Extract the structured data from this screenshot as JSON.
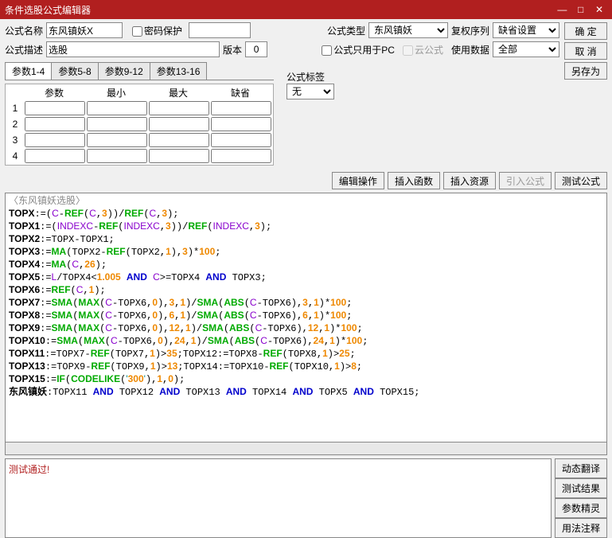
{
  "title": "条件选股公式编辑器",
  "labels": {
    "name": "公式名称",
    "pwd": "密码保护",
    "type": "公式类型",
    "fuquan": "复权序列",
    "desc": "公式描述",
    "ver": "版本",
    "pconly": "公式只用于PC",
    "cloud": "云公式",
    "usedata": "使用数据",
    "tag": "公式标签"
  },
  "fields": {
    "name": "东风镇妖X",
    "desc": "选股",
    "ver": "0",
    "type": "东风镇妖",
    "fuquan": "缺省设置",
    "usedata": "全部",
    "tag": "无"
  },
  "btns": {
    "ok": "确 定",
    "cancel": "取 消",
    "saveas": "另存为",
    "editop": "编辑操作",
    "insfunc": "插入函数",
    "insres": "插入资源",
    "import": "引入公式",
    "test": "测试公式",
    "dyntrans": "动态翻译",
    "testres": "测试结果",
    "paramwiz": "参数精灵",
    "usage": "用法注释"
  },
  "tabs": [
    "参数1-4",
    "参数5-8",
    "参数9-12",
    "参数13-16"
  ],
  "paramhdrs": [
    "参数",
    "最小",
    "最大",
    "缺省"
  ],
  "paramrows": [
    1,
    2,
    3,
    4
  ],
  "status": "测试通过!",
  "code_title": "〈东风镇妖选股〉",
  "chart_data": {
    "type": "table",
    "title": "formula source lines",
    "lines": [
      "TOPX:=(C-REF(C,3))/REF(C,3);",
      "TOPX1:=(INDEXC-REF(INDEXC,3))/REF(INDEXC,3);",
      "TOPX2:=TOPX-TOPX1;",
      "TOPX3:=MA(TOPX2-REF(TOPX2,1),3)*100;",
      "TOPX4:=MA(C,26);",
      "TOPX5:=L/TOPX4<1.005 AND C>=TOPX4 AND TOPX3;",
      "TOPX6:=REF(C,1);",
      "TOPX7:=SMA(MAX(C-TOPX6,0),3,1)/SMA(ABS(C-TOPX6),3,1)*100;",
      "TOPX8:=SMA(MAX(C-TOPX6,0),6,1)/SMA(ABS(C-TOPX6),6,1)*100;",
      "TOPX9:=SMA(MAX(C-TOPX6,0),12,1)/SMA(ABS(C-TOPX6),12,1)*100;",
      "TOPX10:=SMA(MAX(C-TOPX6,0),24,1)/SMA(ABS(C-TOPX6),24,1)*100;",
      "TOPX11:=TOPX7-REF(TOPX7,1)>35;TOPX12:=TOPX8-REF(TOPX8,1)>25;",
      "TOPX13:=TOPX9-REF(TOPX9,1)>13;TOPX14:=TOPX10-REF(TOPX10,1)>8;",
      "TOPX15:=IF(CODELIKE('300'),1,0);",
      "东风镇妖:TOPX11 AND TOPX12 AND TOPX13 AND TOPX14 AND TOPX5 AND TOPX15;"
    ]
  }
}
